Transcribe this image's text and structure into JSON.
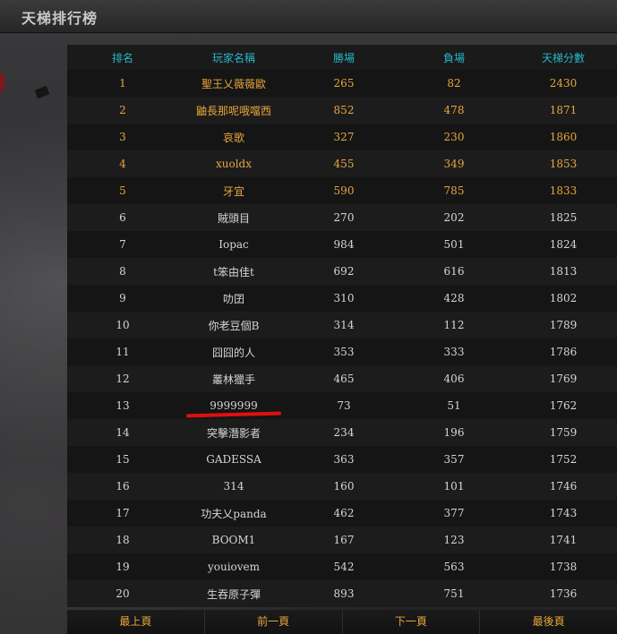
{
  "header": {
    "title": "天梯排行榜"
  },
  "table": {
    "columns": [
      "排名",
      "玩家名稱",
      "勝場",
      "負場",
      "天梯分數"
    ],
    "rows": [
      [
        "1",
        "聖王乂薇薇歐",
        "265",
        "82",
        "2430"
      ],
      [
        "2",
        "鼬長那呢哦噹西",
        "852",
        "478",
        "1871"
      ],
      [
        "3",
        "哀歌",
        "327",
        "230",
        "1860"
      ],
      [
        "4",
        "xuoldx",
        "455",
        "349",
        "1853"
      ],
      [
        "5",
        "牙宜",
        "590",
        "785",
        "1833"
      ],
      [
        "6",
        "賊頭目",
        "270",
        "202",
        "1825"
      ],
      [
        "7",
        "Iopac",
        "984",
        "501",
        "1824"
      ],
      [
        "8",
        "t笨由佳t",
        "692",
        "616",
        "1813"
      ],
      [
        "9",
        "叻囝",
        "310",
        "428",
        "1802"
      ],
      [
        "10",
        "你老豆個B",
        "314",
        "112",
        "1789"
      ],
      [
        "11",
        "囧囧的人",
        "353",
        "333",
        "1786"
      ],
      [
        "12",
        "叢林獵手",
        "465",
        "406",
        "1769"
      ],
      [
        "13",
        "9999999",
        "73",
        "51",
        "1762"
      ],
      [
        "14",
        "突擊潛影者",
        "234",
        "196",
        "1759"
      ],
      [
        "15",
        "GADESSA",
        "363",
        "357",
        "1752"
      ],
      [
        "16",
        "314",
        "160",
        "101",
        "1746"
      ],
      [
        "17",
        "功夫乂panda",
        "462",
        "377",
        "1743"
      ],
      [
        "18",
        "BOOM1",
        "167",
        "123",
        "1741"
      ],
      [
        "19",
        "youiovem",
        "542",
        "563",
        "1738"
      ],
      [
        "20",
        "生吞原子彈",
        "893",
        "751",
        "1736"
      ]
    ]
  },
  "pager": {
    "first": "最上頁",
    "prev": "前一頁",
    "next": "下一頁",
    "last": "最後頁"
  },
  "colors": {
    "top_rank": "#e8a63c",
    "header_text": "#27b7c9",
    "highlight_underline": "#e01010"
  }
}
